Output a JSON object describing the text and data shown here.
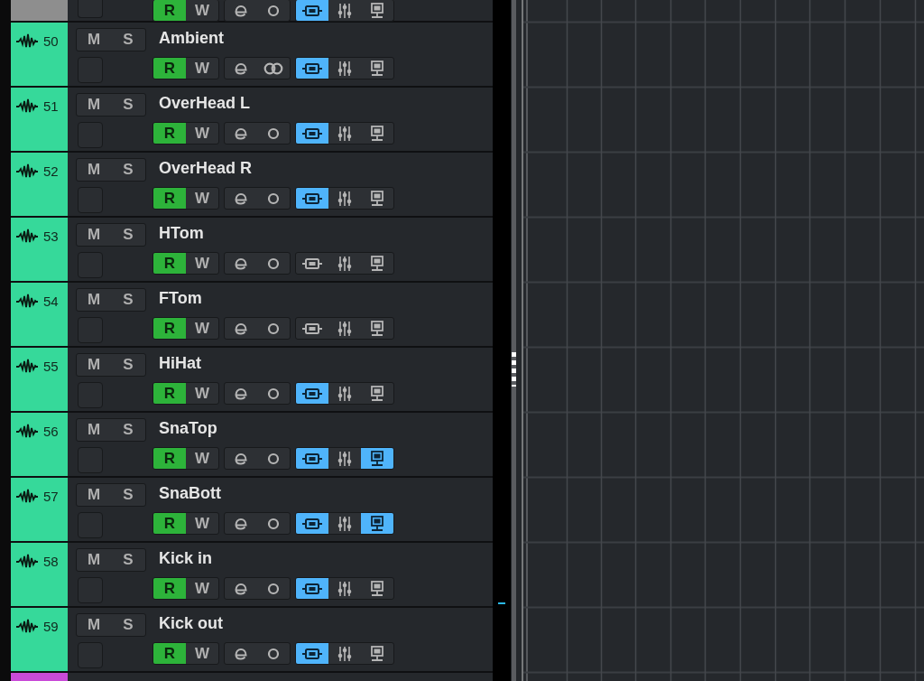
{
  "tracks": [
    {
      "color": "#8e8e8e",
      "read": {
        "label": "R",
        "on": true
      },
      "write": {
        "label": "W",
        "on": false
      },
      "stereo": false,
      "monitor": true,
      "output": false
    },
    {
      "number": "50",
      "name": "Ambient",
      "color": "#36d99a",
      "mute": {
        "label": "M",
        "on": false
      },
      "solo": {
        "label": "S",
        "on": false
      },
      "read": {
        "label": "R",
        "on": true
      },
      "write": {
        "label": "W",
        "on": false
      },
      "stereo": true,
      "monitor": true,
      "output": false
    },
    {
      "number": "51",
      "name": "OverHead L",
      "color": "#36d99a",
      "mute": {
        "label": "M",
        "on": false
      },
      "solo": {
        "label": "S",
        "on": false
      },
      "read": {
        "label": "R",
        "on": true
      },
      "write": {
        "label": "W",
        "on": false
      },
      "stereo": false,
      "monitor": true,
      "output": false
    },
    {
      "number": "52",
      "name": "OverHead R",
      "color": "#36d99a",
      "mute": {
        "label": "M",
        "on": false
      },
      "solo": {
        "label": "S",
        "on": false
      },
      "read": {
        "label": "R",
        "on": true
      },
      "write": {
        "label": "W",
        "on": false
      },
      "stereo": false,
      "monitor": true,
      "output": false
    },
    {
      "number": "53",
      "name": "HTom",
      "color": "#36d99a",
      "mute": {
        "label": "M",
        "on": false
      },
      "solo": {
        "label": "S",
        "on": false
      },
      "read": {
        "label": "R",
        "on": true
      },
      "write": {
        "label": "W",
        "on": false
      },
      "stereo": false,
      "monitor": false,
      "output": false
    },
    {
      "number": "54",
      "name": "FTom",
      "color": "#36d99a",
      "mute": {
        "label": "M",
        "on": false
      },
      "solo": {
        "label": "S",
        "on": false
      },
      "read": {
        "label": "R",
        "on": true
      },
      "write": {
        "label": "W",
        "on": false
      },
      "stereo": false,
      "monitor": false,
      "output": false
    },
    {
      "number": "55",
      "name": "HiHat",
      "color": "#36d99a",
      "mute": {
        "label": "M",
        "on": false
      },
      "solo": {
        "label": "S",
        "on": false
      },
      "read": {
        "label": "R",
        "on": true
      },
      "write": {
        "label": "W",
        "on": false
      },
      "stereo": false,
      "monitor": true,
      "output": false
    },
    {
      "number": "56",
      "name": "SnaTop",
      "color": "#36d99a",
      "mute": {
        "label": "M",
        "on": false
      },
      "solo": {
        "label": "S",
        "on": false
      },
      "read": {
        "label": "R",
        "on": true
      },
      "write": {
        "label": "W",
        "on": false
      },
      "stereo": false,
      "monitor": true,
      "output": true
    },
    {
      "number": "57",
      "name": "SnaBott",
      "color": "#36d99a",
      "mute": {
        "label": "M",
        "on": false
      },
      "solo": {
        "label": "S",
        "on": false
      },
      "read": {
        "label": "R",
        "on": true
      },
      "write": {
        "label": "W",
        "on": false
      },
      "stereo": false,
      "monitor": true,
      "output": true
    },
    {
      "number": "58",
      "name": "Kick in",
      "color": "#36d99a",
      "mute": {
        "label": "M",
        "on": false
      },
      "solo": {
        "label": "S",
        "on": false
      },
      "read": {
        "label": "R",
        "on": true
      },
      "write": {
        "label": "W",
        "on": false
      },
      "stereo": false,
      "monitor": true,
      "output": false
    },
    {
      "number": "59",
      "name": "Kick out",
      "color": "#36d99a",
      "mute": {
        "label": "M",
        "on": false
      },
      "solo": {
        "label": "S",
        "on": false
      },
      "read": {
        "label": "R",
        "on": true
      },
      "write": {
        "label": "W",
        "on": false
      },
      "stereo": false,
      "monitor": true,
      "output": false
    },
    {
      "color": "#c94bd8"
    }
  ]
}
